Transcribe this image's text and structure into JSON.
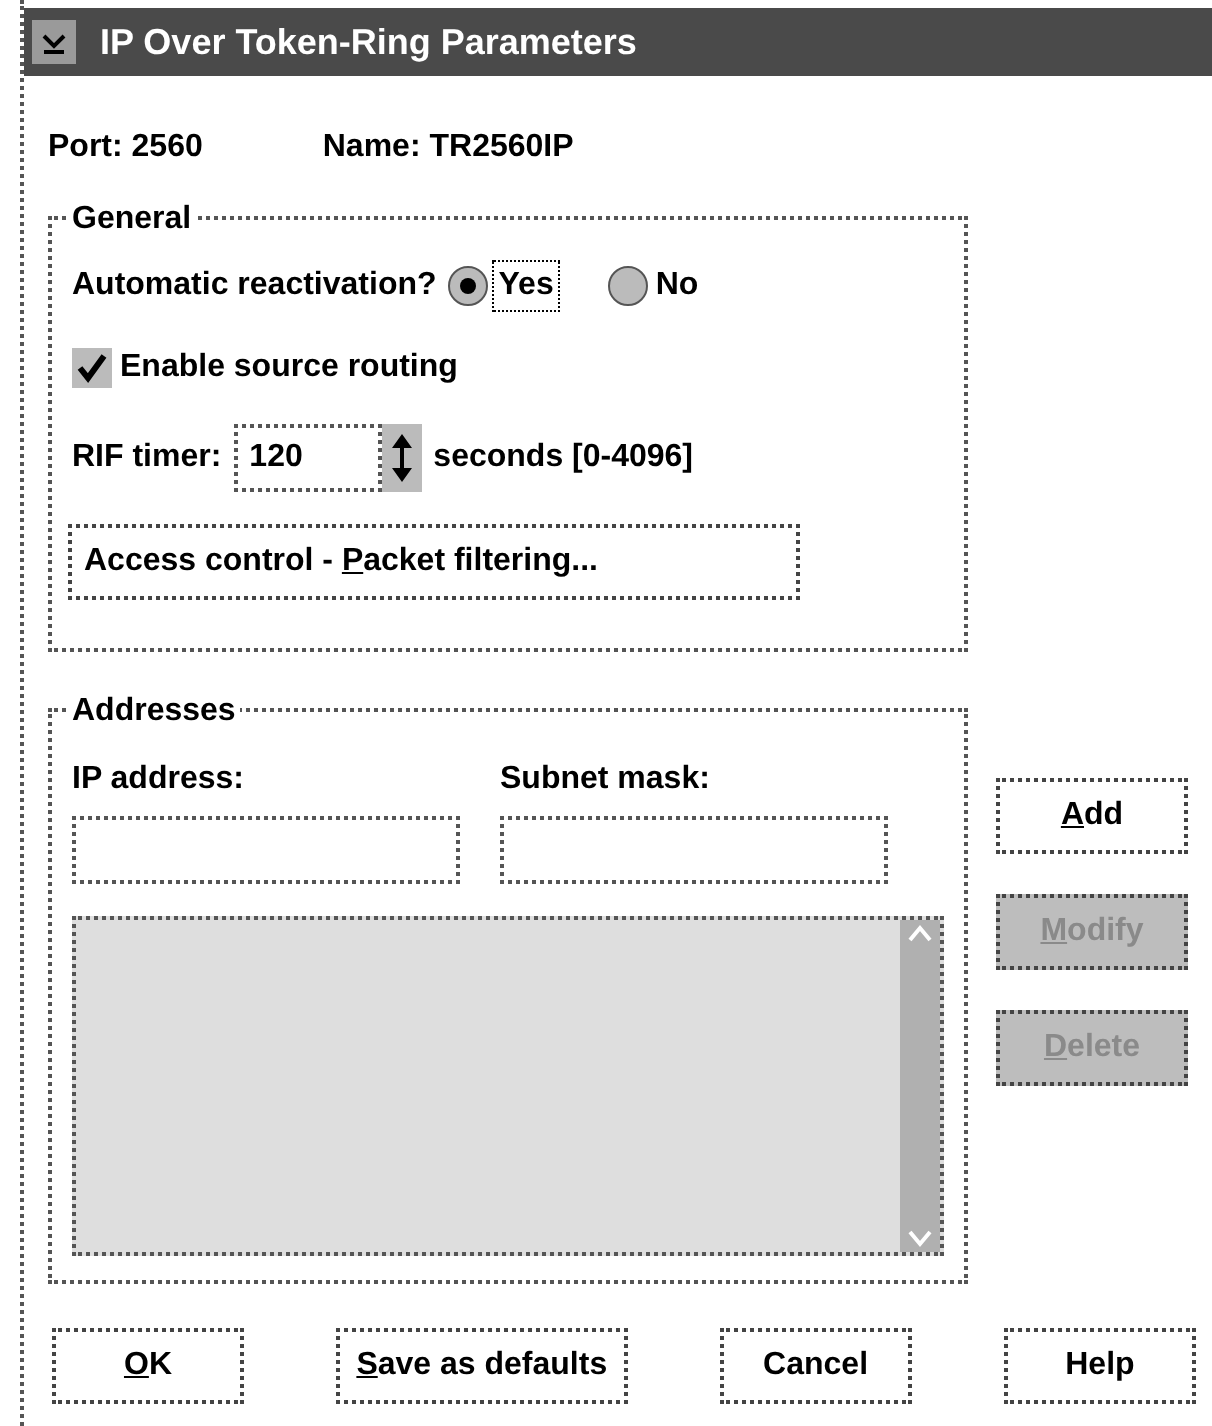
{
  "window": {
    "title": "IP Over Token-Ring Parameters"
  },
  "port": {
    "label": "Port:",
    "value": "2560"
  },
  "name": {
    "label": "Name:",
    "value": "TR2560IP"
  },
  "general": {
    "title": "General",
    "reactivation": {
      "label": "Automatic reactivation?",
      "options": [
        {
          "label": "Yes",
          "selected": true
        },
        {
          "label": "No",
          "selected": false
        }
      ]
    },
    "source_routing": {
      "label": "Enable source routing",
      "checked": true
    },
    "rif_timer": {
      "label": "RIF timer:",
      "value": "120",
      "unit": "seconds [0-4096]"
    },
    "access_button": {
      "pre": "Access control - ",
      "key": "P",
      "post": "acket filtering..."
    }
  },
  "addresses": {
    "title": "Addresses",
    "ip_label": "IP address:",
    "mask_label": "Subnet mask:"
  },
  "side_buttons": [
    {
      "key": "A",
      "post": "dd",
      "disabled": false
    },
    {
      "key": "M",
      "post": "odify",
      "disabled": true
    },
    {
      "key": "D",
      "post": "elete",
      "disabled": true
    }
  ],
  "buttons": [
    {
      "key": "O",
      "post": "K"
    },
    {
      "key": "S",
      "post": "ave as defaults"
    },
    {
      "pre": "Cancel"
    },
    {
      "pre": "Help"
    }
  ]
}
